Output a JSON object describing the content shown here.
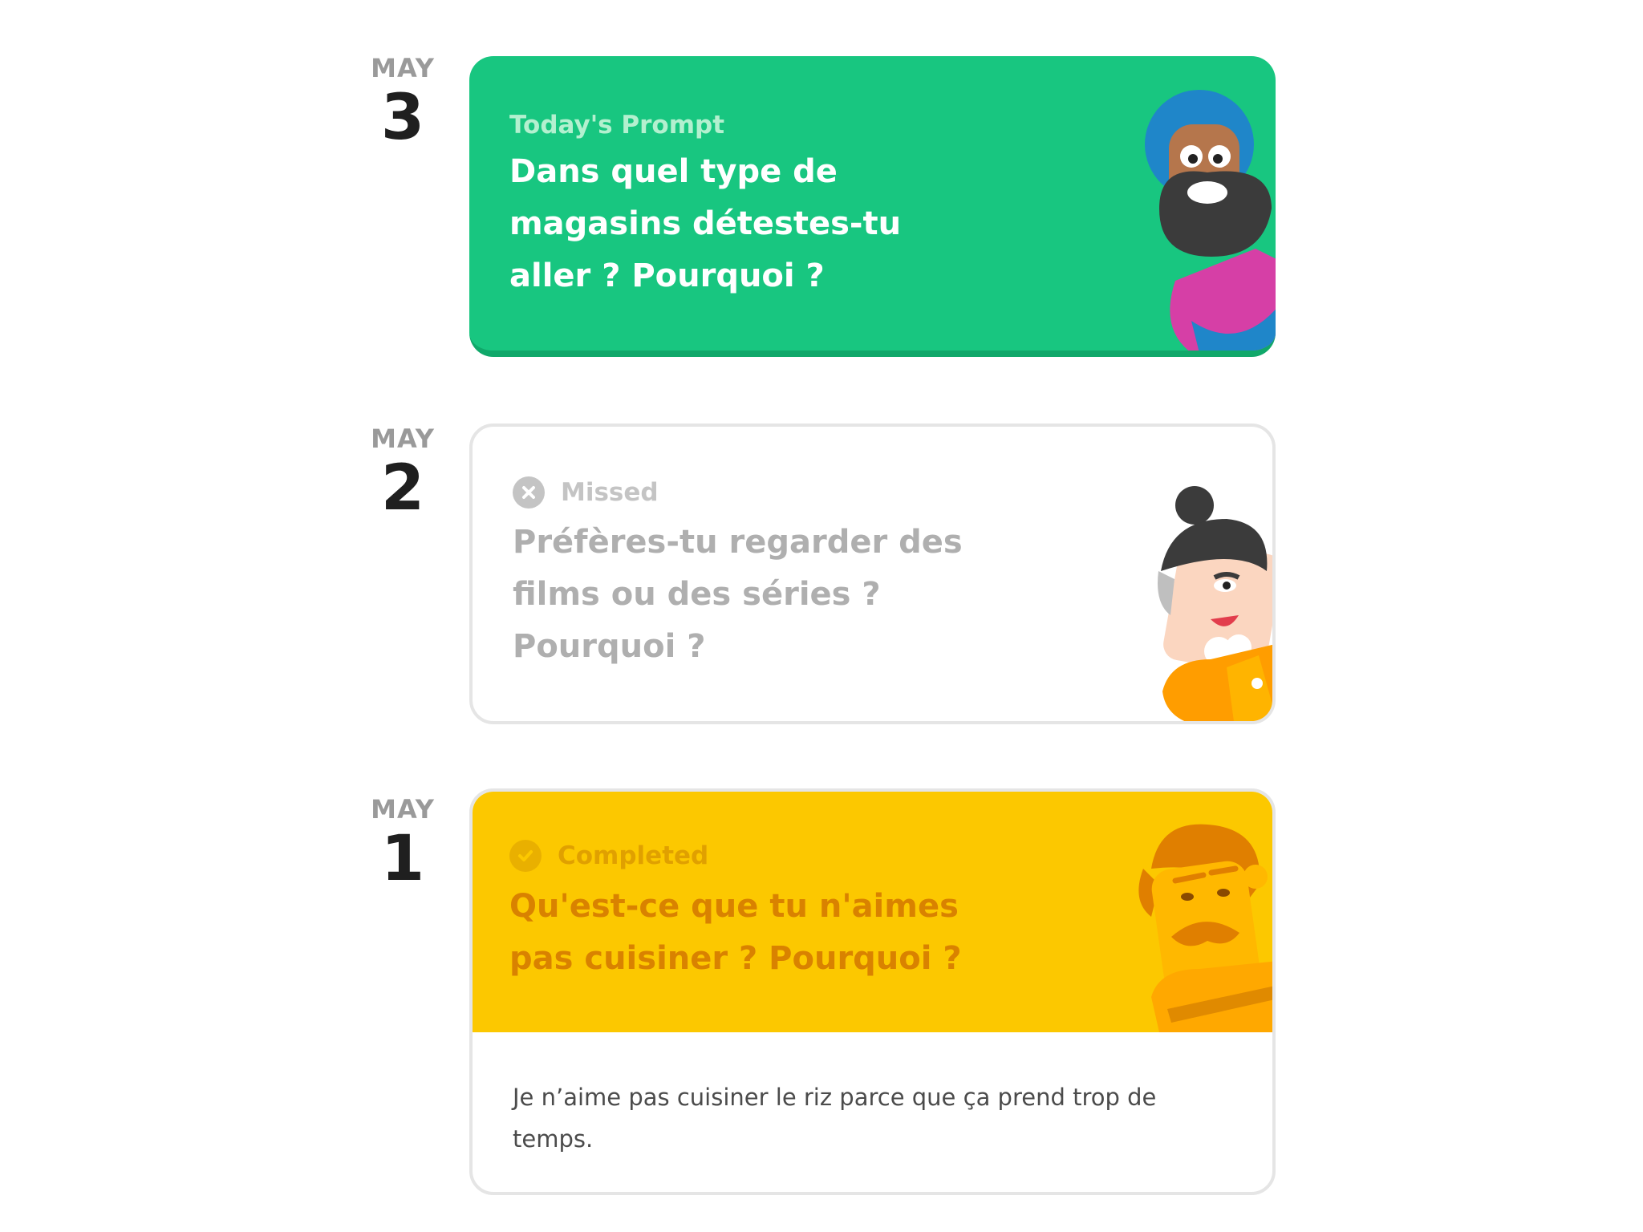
{
  "entries": [
    {
      "month": "MAY",
      "day": "3",
      "status": "Today's Prompt",
      "prompt": "Dans quel type de magasins détestes-tu aller ? Pourquoi ?",
      "character_icon": "turban-man-icon",
      "color": "#18c680"
    },
    {
      "month": "MAY",
      "day": "2",
      "status": "Missed",
      "prompt": "Préfères-tu regarder des films ou des séries ? Pourquoi ?",
      "character_icon": "bun-lady-icon",
      "status_icon": "x-circle-icon"
    },
    {
      "month": "MAY",
      "day": "1",
      "status": "Completed",
      "prompt": "Qu'est-ce que tu n'aimes pas cuisiner ? Pourquoi ?",
      "character_icon": "mustache-man-icon",
      "status_icon": "check-circle-icon",
      "answer": "Je n’aime pas cuisiner le riz parce que ça prend trop de temps.",
      "color": "#fcc800"
    }
  ]
}
